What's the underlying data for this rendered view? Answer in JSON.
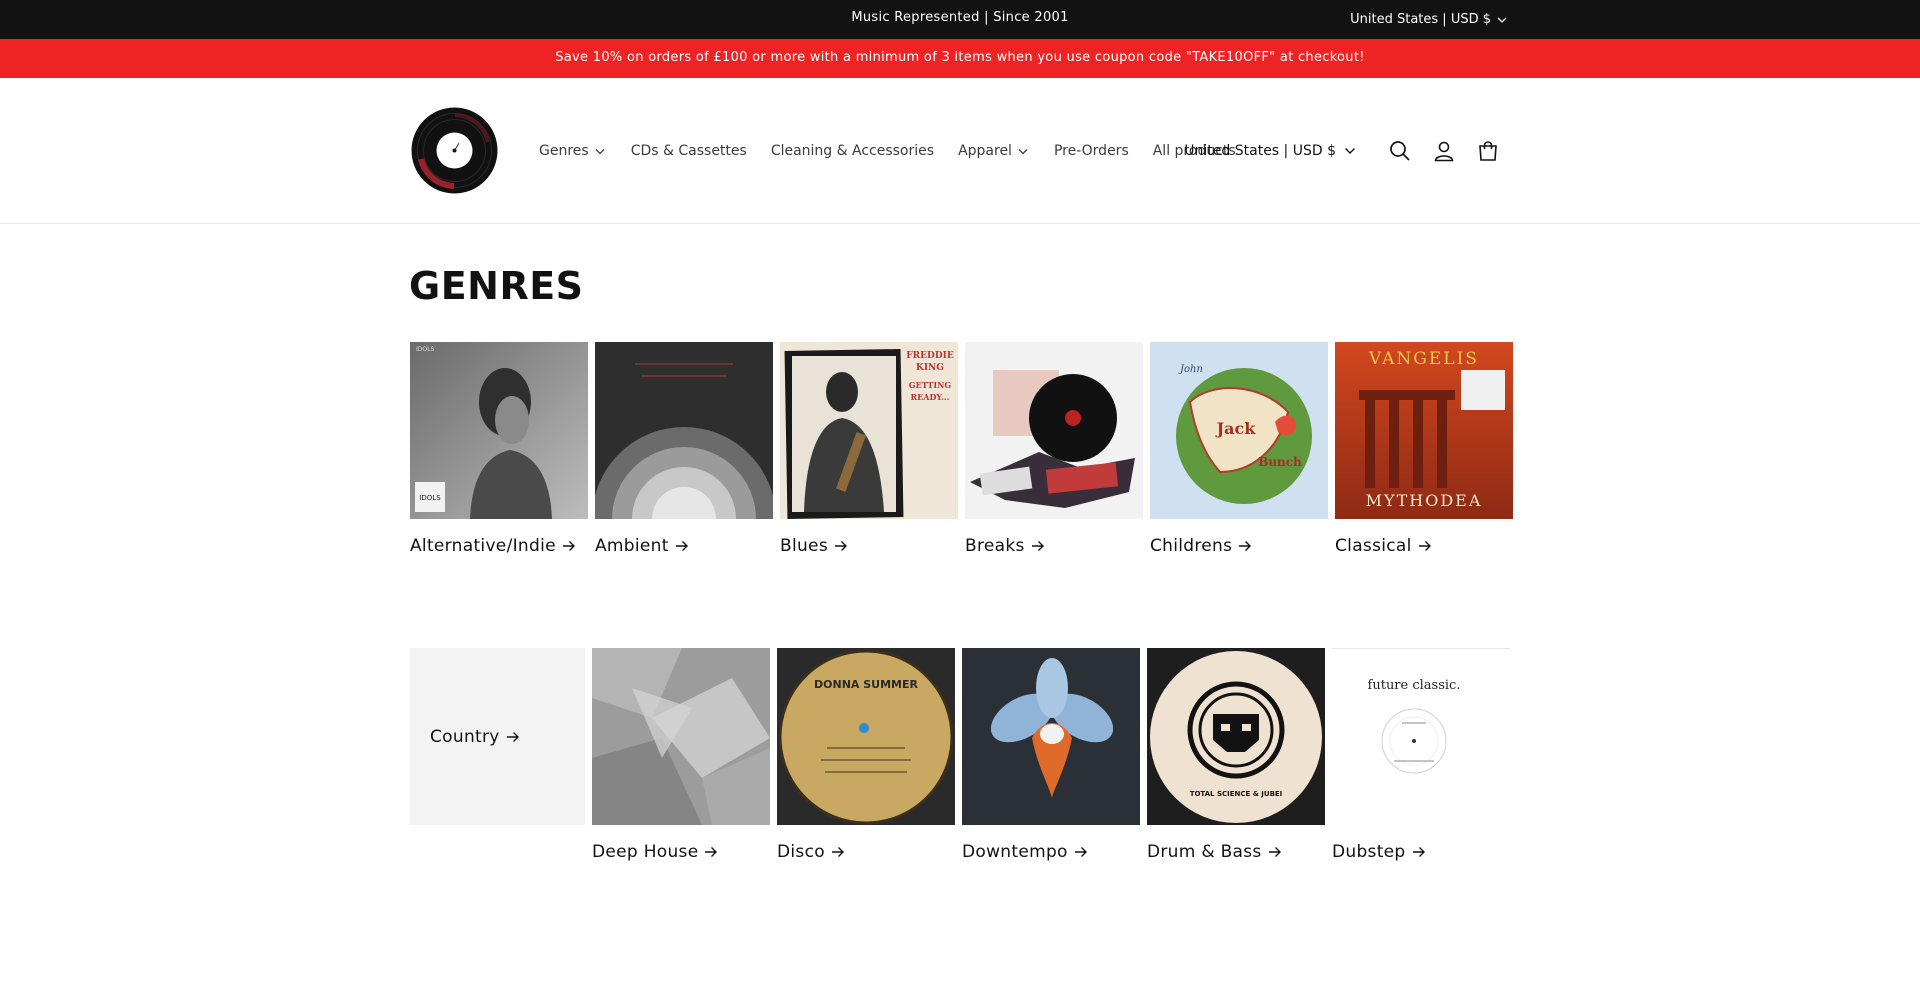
{
  "announcement": {
    "text": "Music Represented | Since 2001",
    "country": "United States | USD $"
  },
  "promo": {
    "text": "Save 10% on orders of £100 or more with a minimum of 3 items when you use coupon code \"TAKE10OFF\" at checkout!"
  },
  "header": {
    "logo": "vinyl-record-logo",
    "nav": [
      {
        "label": "Genres",
        "dropdown": true
      },
      {
        "label": "CDs & Cassettes",
        "dropdown": false
      },
      {
        "label": "Cleaning & Accessories",
        "dropdown": false
      },
      {
        "label": "Apparel",
        "dropdown": true
      },
      {
        "label": "Pre-Orders",
        "dropdown": false
      },
      {
        "label": "All products",
        "dropdown": false
      }
    ],
    "country": "United States | USD $",
    "icons": [
      "search-icon",
      "account-icon",
      "cart-icon"
    ]
  },
  "main": {
    "title": "GENRES",
    "genres": [
      {
        "label": "Alternative/Indie",
        "art": {
          "text": "IDOLS",
          "color": "#7d7d7d"
        }
      },
      {
        "label": "Ambient",
        "art": {
          "text": "",
          "color": "#3a3a3a"
        }
      },
      {
        "label": "Blues",
        "art": {
          "text": "FREDDIE KING GETTING READY...",
          "color": "#ede3d4"
        }
      },
      {
        "label": "Breaks",
        "art": {
          "text": "",
          "color": "#f2f2f2"
        }
      },
      {
        "label": "Childrens",
        "art": {
          "text": "",
          "color": "#c9dcef"
        }
      },
      {
        "label": "Classical",
        "art": {
          "text": "VANGELIS MYTHODEA",
          "color": "#c23a1e"
        }
      },
      {
        "label": "Country",
        "art": {
          "text": "",
          "color": "#f3f3f3"
        }
      },
      {
        "label": "Deep House",
        "art": {
          "text": "",
          "color": "#9a9a9a"
        }
      },
      {
        "label": "Disco",
        "art": {
          "text": "DONNA SUMMER",
          "color": "#c8a867"
        }
      },
      {
        "label": "Downtempo",
        "art": {
          "text": "",
          "color": "#2a2e33"
        }
      },
      {
        "label": "Drum & Bass",
        "art": {
          "text": "TOTAL SCIENCE & JUBEI",
          "color": "#efe2d0"
        }
      },
      {
        "label": "Dubstep",
        "art": {
          "text": "future classic.",
          "color": "#ffffff"
        }
      }
    ]
  },
  "colors": {
    "topbar": "#121212",
    "promo": "#ee2324",
    "text": "#121212"
  }
}
